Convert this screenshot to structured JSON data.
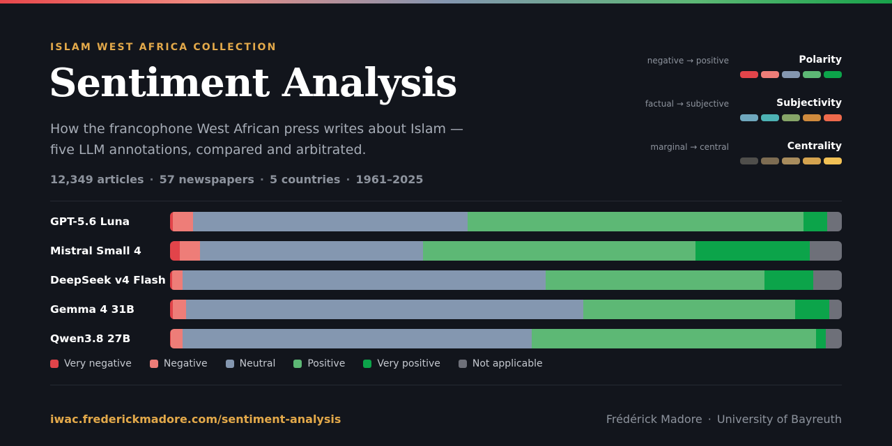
{
  "header": {
    "eyebrow": "ISLAM WEST AFRICA COLLECTION",
    "title": "Sentiment Analysis",
    "subtitle_line1": "How the francophone West African press writes about Islam —",
    "subtitle_line2": "five LLM annotations, compared and arbitrated.",
    "stats": [
      "12,349 articles",
      "57 newspapers",
      "5 countries",
      "1961–2025"
    ],
    "separator": "·"
  },
  "scales": [
    {
      "name": "Polarity",
      "hint": "negative → positive",
      "colors": [
        "#e2444a",
        "#ee7d78",
        "#8497b0",
        "#5db875",
        "#0ca44a"
      ]
    },
    {
      "name": "Subjectivity",
      "hint": "factual → subjective",
      "colors": [
        "#6fa7bd",
        "#4db2b4",
        "#86a568",
        "#cf8a3d",
        "#ee6a4c"
      ]
    },
    {
      "name": "Centrality",
      "hint": "marginal → central",
      "colors": [
        "#4f4e4b",
        "#7d6c52",
        "#a88c5d",
        "#d4a34f",
        "#f2c155"
      ]
    }
  ],
  "chart_data": {
    "type": "bar",
    "stacked": true,
    "orientation": "horizontal",
    "normalized_to": 100,
    "categories": [
      "GPT-5.6 Luna",
      "Mistral Small 4",
      "DeepSeek v4 Flash",
      "Gemma 4 31B",
      "Qwen3.8 27B"
    ],
    "series": [
      {
        "name": "Very negative",
        "color": "#e2444a",
        "values": [
          0.4,
          1.5,
          0.3,
          0.4,
          0.1
        ]
      },
      {
        "name": "Negative",
        "color": "#ee7d78",
        "values": [
          3.0,
          3.0,
          1.6,
          2.0,
          1.8
        ]
      },
      {
        "name": "Neutral",
        "color": "#8497b0",
        "values": [
          40.9,
          33.2,
          54.0,
          59.1,
          52.0
        ]
      },
      {
        "name": "Positive",
        "color": "#5db875",
        "values": [
          50.0,
          40.6,
          32.6,
          31.5,
          42.3
        ]
      },
      {
        "name": "Very positive",
        "color": "#0ca44a",
        "values": [
          3.5,
          17.0,
          7.3,
          5.1,
          1.5
        ]
      },
      {
        "name": "Not applicable",
        "color": "#6e7079",
        "values": [
          2.2,
          4.7,
          4.2,
          1.9,
          2.3
        ]
      }
    ]
  },
  "footer": {
    "link": "iwac.frederickmadore.com/sentiment-analysis",
    "author": "Frédérick Madore",
    "affiliation": "University of Bayreuth",
    "separator": "·"
  }
}
